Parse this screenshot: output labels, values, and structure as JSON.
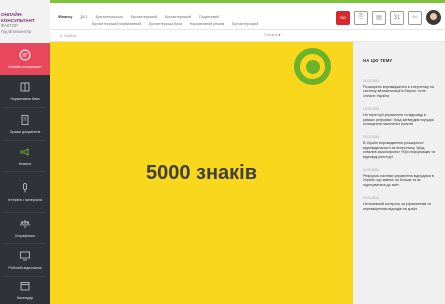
{
  "brand": {
    "line1": "ОНЛАЙН-",
    "line2": "КОНСУЛЬТАНТ",
    "line3": "ФАКТОР",
    "line4": "Гуд Вполкинтер"
  },
  "sidebar": {
    "items": [
      {
        "label": "Онлайн-консультант",
        "icon": "chat-icon",
        "active": true
      },
      {
        "label": "Нормативна база",
        "icon": "book-icon",
        "active": false
      },
      {
        "label": "Зразки документів",
        "icon": "document-icon",
        "active": false
      },
      {
        "label": "Новини",
        "icon": "megaphone-icon",
        "active": false
      },
      {
        "label": "Інтерв’ю і матеріали",
        "icon": "microphone-icon",
        "active": false
      },
      {
        "label": "Штрафники",
        "icon": "scale-icon",
        "active": false
      },
      {
        "label": "Робочий відпочинок",
        "icon": "monitor-icon",
        "active": false
      },
      {
        "label": "Календар",
        "icon": "calendar-icon",
        "active": false
      }
    ]
  },
  "tabs": {
    "row1": [
      "Фінансу",
      "Дії 1",
      "Бухгалтерського",
      "Бухгалтерський",
      "Бухгалтерський",
      "Податковий"
    ],
    "row2": [
      "Бухгалтерський нормативний",
      "Бухгалтерська база",
      "Нормативний режим",
      "Бухгалтерський"
    ]
  },
  "toolbar": {
    "red_badge": "CO",
    "icon_labels": [
      "⎘",
      "▤",
      "31",
      "✄"
    ]
  },
  "subbar": {
    "find_label": "Знайти",
    "find_placeholder": "Знайти",
    "right_label": "Головна"
  },
  "main": {
    "headline": "5000 знаків"
  },
  "rightcol": {
    "title": "НА ЦЮ ТЕМУ",
    "news": [
      {
        "date": "14.03.2024",
        "text": "Розширено впровадження в енергетику на систему автоматизації в Європі: тісне спільне Україна"
      },
      {
        "date": "13.03.2024",
        "text": "На території управління та відповіді в рамках реформи: Уряд затвердив порядок оснащення населених пунктів"
      },
      {
        "date": "12.03.2024",
        "text": "В Україні впровадження розширеної відповідальності за енергетику. Уряд схвалив законопроект «Про інформацію та відповіді реєстру»"
      },
      {
        "date": "11.03.2024",
        "text": "Реформа системи управління відходами в Україні: що змінює на більше та як підготуватися до змін"
      },
      {
        "date": "10.03.2024",
        "text": "Неналежний контроль за утриманням та переміщенням відходів на країні"
      }
    ]
  },
  "colors": {
    "accent_green": "#6cb32c",
    "content_yellow": "#f9d71c",
    "sidebar_dark": "#2f3236",
    "active_red": "#e9475b"
  }
}
